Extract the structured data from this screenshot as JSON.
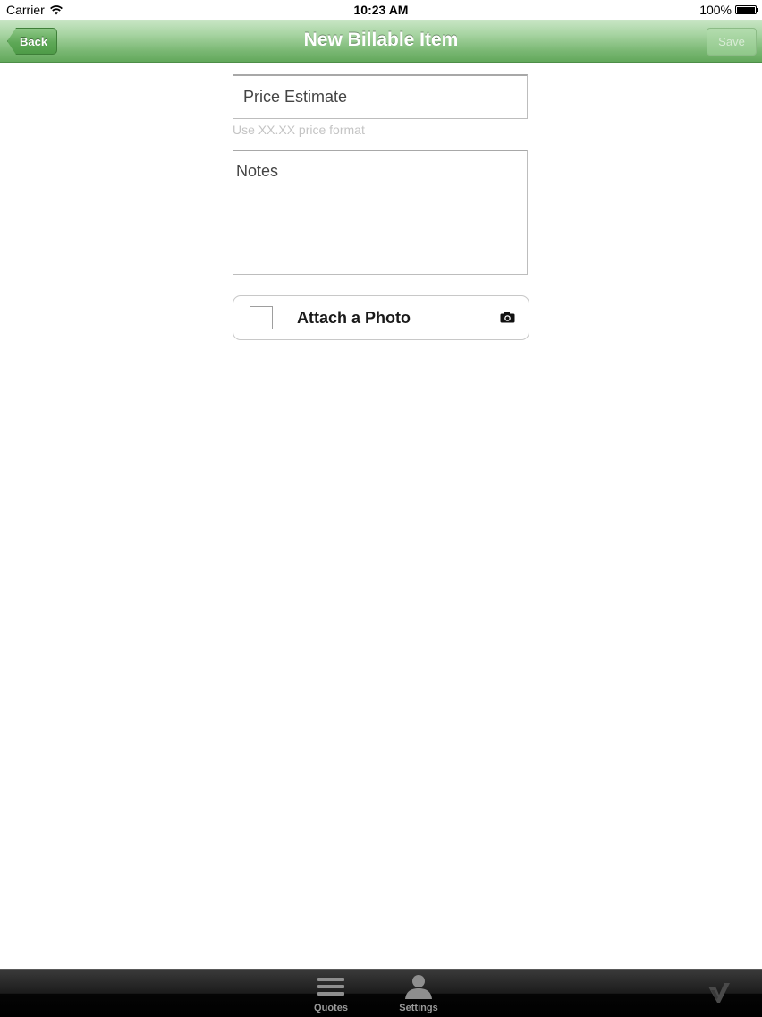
{
  "status_bar": {
    "carrier": "Carrier",
    "time": "10:23 AM",
    "battery": "100%",
    "battery_level": 1.0
  },
  "nav_bar": {
    "title": "New Billable Item",
    "back_label": "Back",
    "save_label": "Save"
  },
  "form": {
    "price": {
      "placeholder": "Price Estimate",
      "value": "",
      "hint": "Use XX.XX price format"
    },
    "notes": {
      "placeholder": "Notes",
      "value": ""
    },
    "attach_photo": {
      "label": "Attach a Photo",
      "checked": false,
      "icon": "camera-icon"
    }
  },
  "tab_bar": {
    "items": [
      {
        "label": "Quotes",
        "icon": "list-icon"
      },
      {
        "label": "Settings",
        "icon": "person-icon"
      }
    ],
    "logo_icon": "brand-logo-icon"
  },
  "colors": {
    "nav_green_top": "#c9e6c6",
    "nav_green_bottom": "#62a85b",
    "hint_gray": "#c4c4c4",
    "tab_bar_bg": "#1c1c1c",
    "tab_label": "#9a9a9a"
  }
}
